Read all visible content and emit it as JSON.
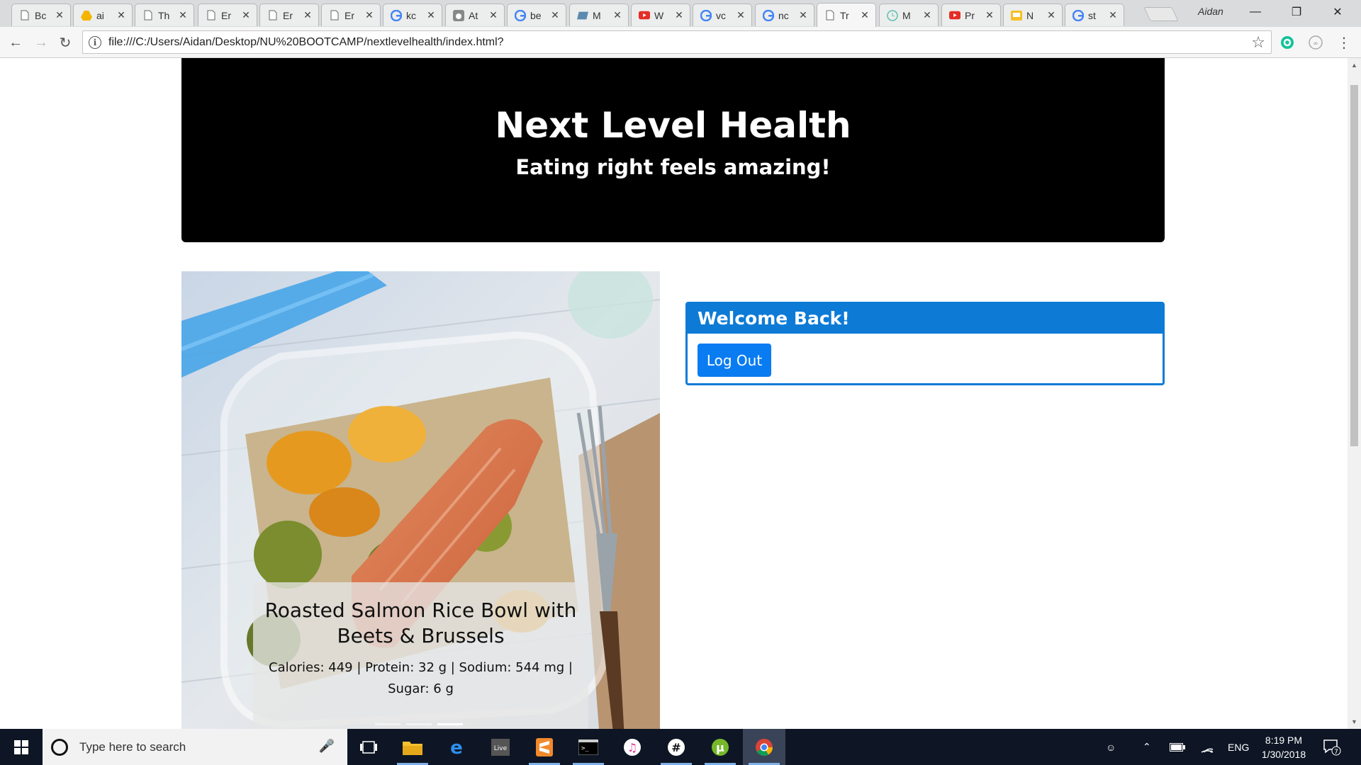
{
  "browser": {
    "tabs": [
      {
        "title": "Bc",
        "icon": "page-icon"
      },
      {
        "title": "ai",
        "icon": "drive-icon"
      },
      {
        "title": "Th",
        "icon": "page-icon"
      },
      {
        "title": "Er",
        "icon": "page-icon"
      },
      {
        "title": "Er",
        "icon": "page-icon"
      },
      {
        "title": "Er",
        "icon": "page-icon"
      },
      {
        "title": "kc",
        "icon": "google-icon"
      },
      {
        "title": "At",
        "icon": "apple-icon"
      },
      {
        "title": "be",
        "icon": "google-icon"
      },
      {
        "title": "M",
        "icon": "folder-icon"
      },
      {
        "title": "W",
        "icon": "youtube-icon"
      },
      {
        "title": "vc",
        "icon": "google-icon"
      },
      {
        "title": "nc",
        "icon": "google-icon"
      },
      {
        "title": "Tr",
        "icon": "page-icon",
        "active": true
      },
      {
        "title": "M",
        "icon": "clock-icon"
      },
      {
        "title": "Pr",
        "icon": "youtube-icon"
      },
      {
        "title": "N",
        "icon": "keep-icon"
      },
      {
        "title": "st",
        "icon": "google-icon"
      }
    ],
    "profile_name": "Aidan",
    "url": "file:///C:/Users/Aidan/Desktop/NU%20BOOTCAMP/nextlevelhealth/index.html?"
  },
  "page": {
    "jumbotron": {
      "title": "Next Level Health",
      "subtitle": "Eating right feels amazing!"
    },
    "carousel": {
      "slide_title": "Roasted Salmon Rice Bowl with Beets & Brussels",
      "slide_nutrition": "Calories: 449 | Protein: 32 g | Sodium: 544 mg | Sugar: 6 g",
      "indicator_count": 3,
      "active_indicator": 3
    },
    "welcome_card": {
      "header": "Welcome Back!",
      "button": "Log Out"
    }
  },
  "taskbar": {
    "search_placeholder": "Type here to search",
    "apps": [
      "task-view-icon",
      "file-explorer-icon",
      "edge-icon",
      "live-icon",
      "sublime-icon",
      "terminal-icon",
      "itunes-icon",
      "slack-icon",
      "utorrent-icon",
      "chrome-icon"
    ],
    "language": "ENG",
    "time": "8:19 PM",
    "date": "1/30/2018",
    "notification_count": "7"
  },
  "colors": {
    "jumbotron_bg": "#000000",
    "card_accent": "#0d7bd6",
    "button_bg": "#0a7cf2",
    "taskbar_bg": "#0e1625"
  }
}
